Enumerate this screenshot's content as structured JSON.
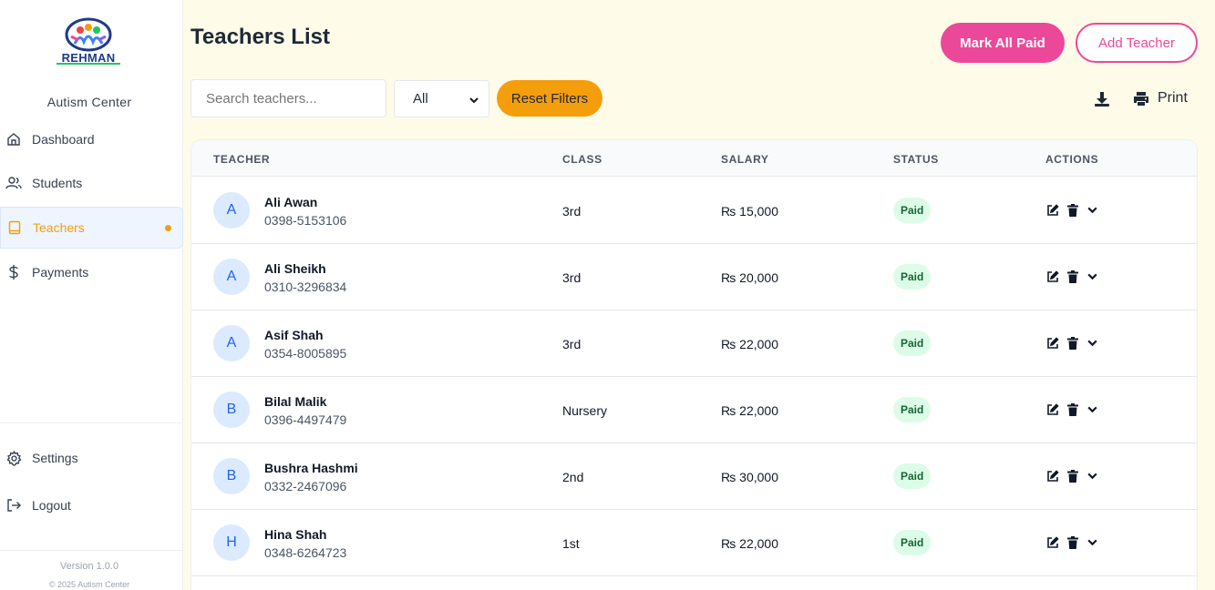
{
  "brand": {
    "logo_text": "REHMAN",
    "center_name": "Autism Center"
  },
  "sidebar": {
    "items": [
      {
        "label": "Dashboard",
        "icon": "home-icon"
      },
      {
        "label": "Students",
        "icon": "users-icon"
      },
      {
        "label": "Teachers",
        "icon": "book-icon",
        "active": true
      },
      {
        "label": "Payments",
        "icon": "dollar-icon"
      }
    ],
    "bottom": [
      {
        "label": "Settings",
        "icon": "gear-icon"
      },
      {
        "label": "Logout",
        "icon": "logout-icon"
      }
    ],
    "version": "Version 1.0.0",
    "copyright": "© 2025 Autism Center"
  },
  "header": {
    "title": "Teachers List",
    "mark_all_paid": "Mark All Paid",
    "add_teacher": "Add Teacher"
  },
  "filters": {
    "search_placeholder": "Search teachers...",
    "select_value": "All",
    "reset_label": "Reset Filters",
    "print_label": "Print"
  },
  "table": {
    "columns": [
      "TEACHER",
      "CLASS",
      "SALARY",
      "STATUS",
      "ACTIONS"
    ],
    "rows": [
      {
        "initial": "A",
        "name": "Ali Awan",
        "phone": "0398-5153106",
        "class": "3rd",
        "salary": "₨ 15,000",
        "status": "Paid"
      },
      {
        "initial": "A",
        "name": "Ali Sheikh",
        "phone": "0310-3296834",
        "class": "3rd",
        "salary": "₨ 20,000",
        "status": "Paid"
      },
      {
        "initial": "A",
        "name": "Asif Shah",
        "phone": "0354-8005895",
        "class": "3rd",
        "salary": "₨ 22,000",
        "status": "Paid"
      },
      {
        "initial": "B",
        "name": "Bilal Malik",
        "phone": "0396-4497479",
        "class": "Nursery",
        "salary": "₨ 22,000",
        "status": "Paid"
      },
      {
        "initial": "B",
        "name": "Bushra Hashmi",
        "phone": "0332-2467096",
        "class": "2nd",
        "salary": "₨ 30,000",
        "status": "Paid"
      },
      {
        "initial": "H",
        "name": "Hina Shah",
        "phone": "0348-6264723",
        "class": "1st",
        "salary": "₨ 22,000",
        "status": "Paid"
      }
    ]
  },
  "colors": {
    "accent": "#ec4899",
    "active_nav": "#f59e0b",
    "reset_button": "#f59e0b",
    "paid_badge_bg": "#dcfce7",
    "avatar_bg": "#dbeafe"
  }
}
